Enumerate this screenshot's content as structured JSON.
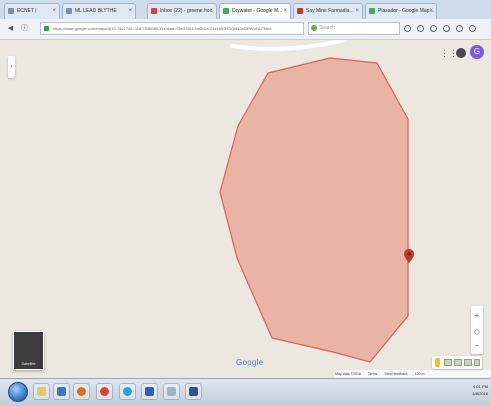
{
  "browser": {
    "tabs": [
      {
        "label": "ECNET |",
        "active": false
      },
      {
        "label": "ML LEAD BLYTHE",
        "active": false
      },
      {
        "label": "Inbox (22) - greene.ho...",
        "active": false
      },
      {
        "label": "Drywater - Google M...",
        "active": true
      },
      {
        "label": "Say Mine Farmadla...",
        "active": false
      },
      {
        "label": "Plasador - Google Map...",
        "active": false
      }
    ],
    "url": "https://www.google.com/maps/@33.7467748,-116.7536085,17z/data=!3m1!4b1!4m2!6m1!1s1b99HDQf4z3xQRWVNLFMn6",
    "search_placeholder": "Search",
    "toolbar_icons": [
      "star-icon",
      "home-icon",
      "download-icon",
      "shield-icon",
      "menu-icon"
    ]
  },
  "map": {
    "account_initial": "G",
    "logo_text": "Google",
    "satellite_label": "Satellite",
    "footer": [
      "Map data ©2016",
      "Terms",
      "Send feedback",
      "100 m"
    ],
    "polygon_fill": "#e9a99b",
    "polygon_stroke": "#d9625a",
    "marker_color": "#c0392b",
    "land_color": "#ece8df"
  },
  "taskbar": {
    "apps": [
      {
        "name": "explorer",
        "color": "#e8c66a"
      },
      {
        "name": "outlook",
        "color": "#3a77c4"
      },
      {
        "name": "firefox",
        "color": "#e06a2a"
      },
      {
        "name": "chrome",
        "color": "#d9453a"
      },
      {
        "name": "skype",
        "color": "#2aa2dc"
      },
      {
        "name": "app-blue",
        "color": "#2b5fbf"
      },
      {
        "name": "notepad",
        "color": "#9fb4c8"
      },
      {
        "name": "word",
        "color": "#2a5699"
      }
    ],
    "clock_time": "9:01 PM",
    "clock_date": "4/8/2016"
  }
}
